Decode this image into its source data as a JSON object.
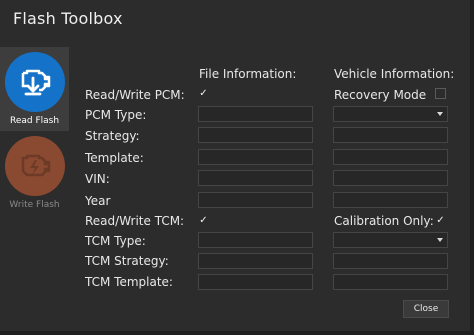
{
  "window": {
    "title": "Flash Toolbox"
  },
  "sidebar": {
    "items": [
      {
        "label": "Read Flash",
        "icon": "engine-download-icon",
        "selected": true
      },
      {
        "label": "Write Flash",
        "icon": "engine-flash-icon",
        "selected": false
      }
    ]
  },
  "headers": {
    "file_info": "File Information:",
    "vehicle_info": "Vehicle Information:"
  },
  "labels": {
    "rw_pcm": "Read/Write PCM:",
    "pcm_type": "PCM Type:",
    "strategy": "Strategy:",
    "template": "Template:",
    "vin": "VIN:",
    "year": "Year",
    "rw_tcm": "Read/Write TCM:",
    "tcm_type": "TCM Type:",
    "tcm_strategy": "TCM Strategy:",
    "tcm_template": "TCM Template:",
    "recovery_mode": "Recovery Mode",
    "calibration_only": "Calibration Only:"
  },
  "checks": {
    "rw_pcm": true,
    "rw_tcm": true,
    "recovery_mode": false,
    "calibration_only": true,
    "mark": "✓"
  },
  "buttons": {
    "close": "Close"
  },
  "colors": {
    "accent_blue": "#1473c9",
    "disabled_orange": "#8a4a31"
  }
}
